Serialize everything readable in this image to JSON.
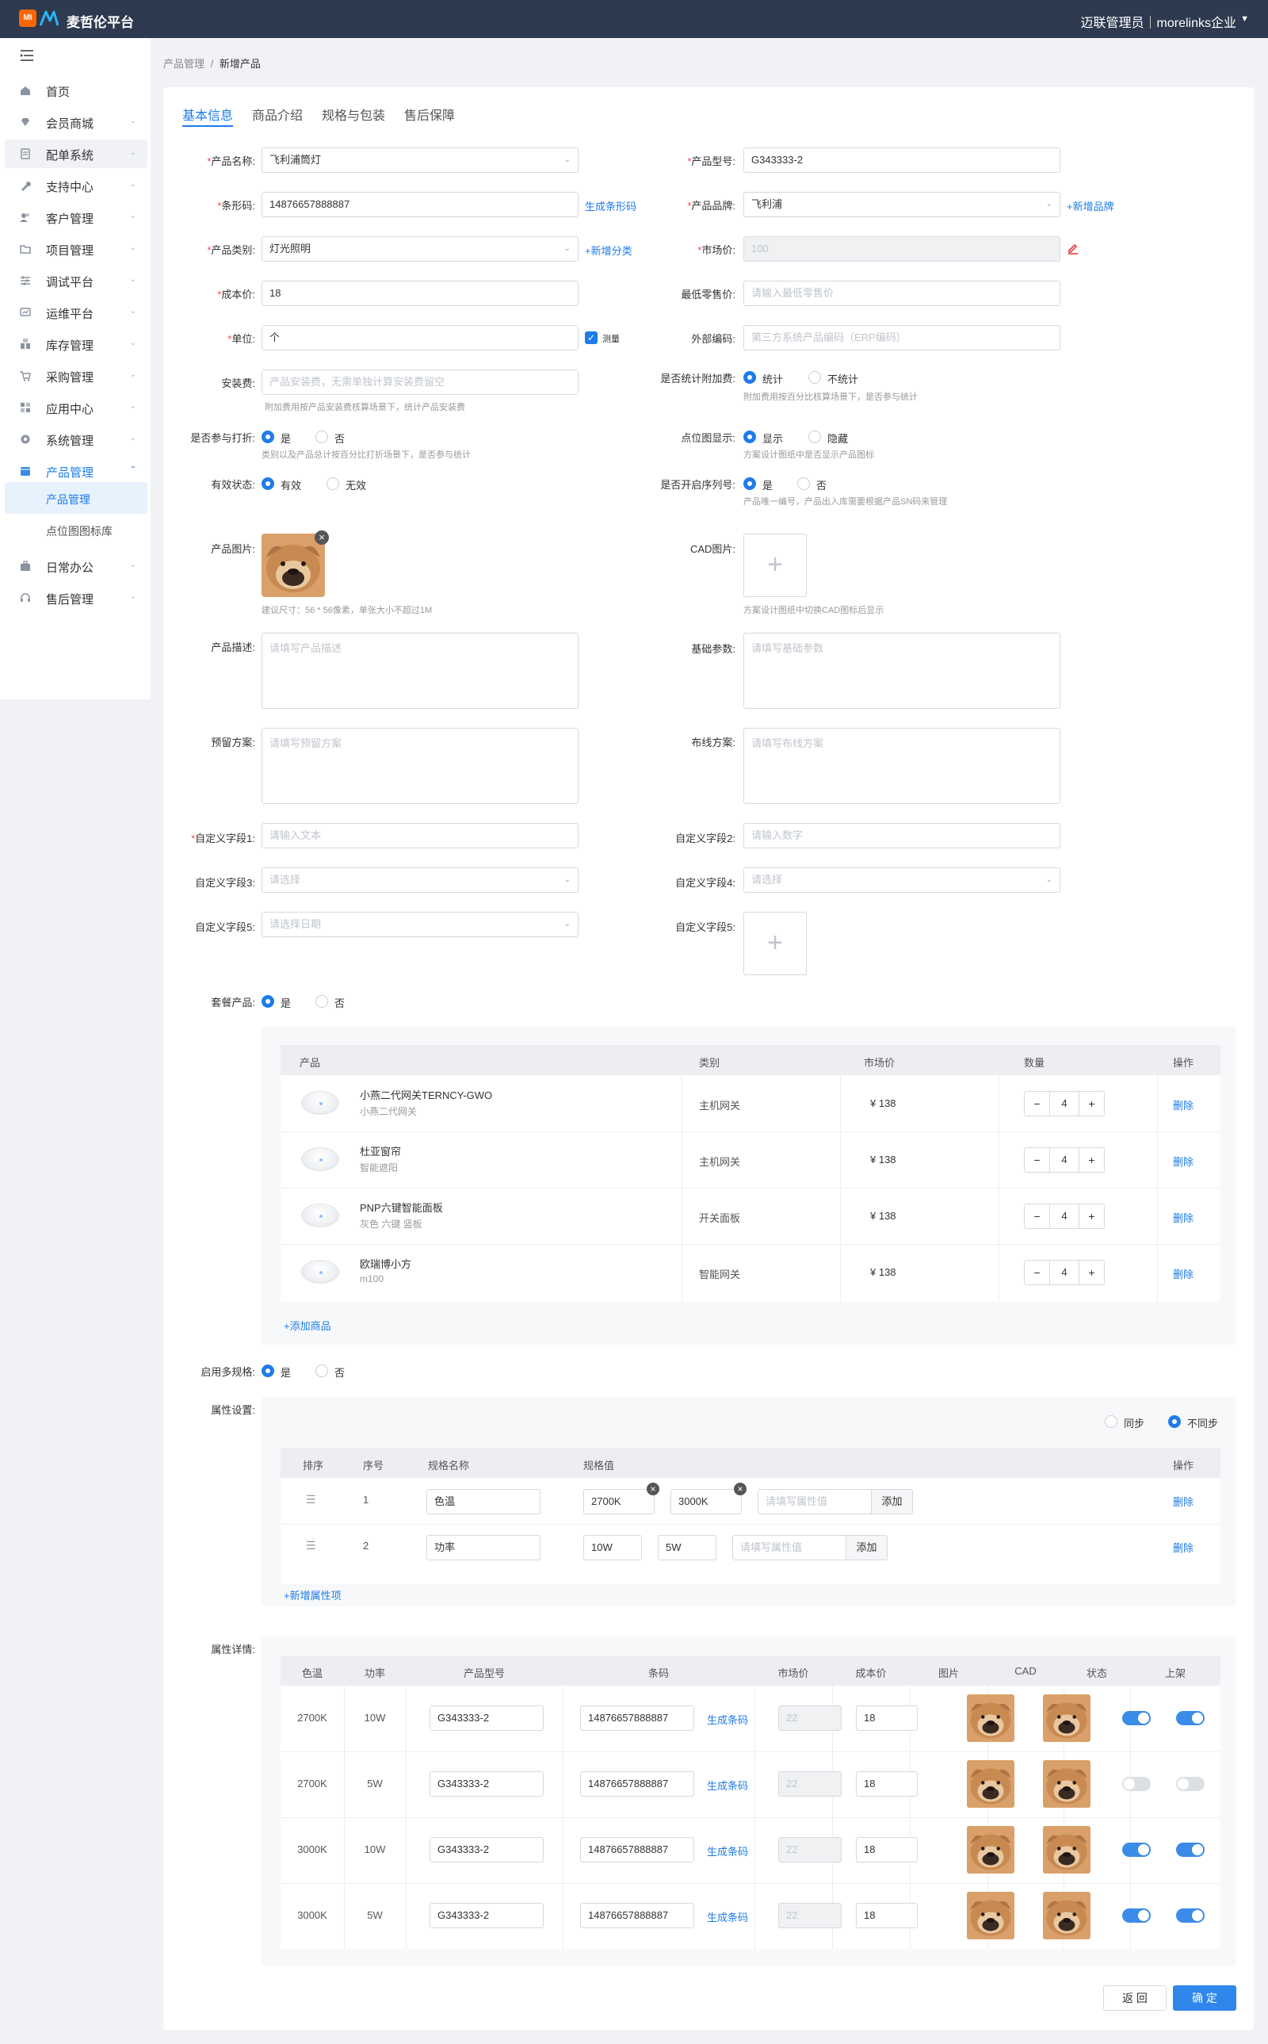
{
  "app": {
    "logo_text": "MI",
    "title": "麦哲伦平台",
    "user": "迈联管理员｜morelinks企业"
  },
  "sidebar": {
    "items": [
      {
        "label": "首页",
        "icon": "home-icon"
      },
      {
        "label": "会员商城",
        "icon": "diamond-icon"
      },
      {
        "label": "配单系统",
        "icon": "order-icon"
      },
      {
        "label": "支持中心",
        "icon": "wrench-icon"
      },
      {
        "label": "客户管理",
        "icon": "customer-icon"
      },
      {
        "label": "项目管理",
        "icon": "folder-icon"
      },
      {
        "label": "调试平台",
        "icon": "sliders-icon"
      },
      {
        "label": "运维平台",
        "icon": "monitor-icon"
      },
      {
        "label": "库存管理",
        "icon": "warehouse-icon"
      },
      {
        "label": "采购管理",
        "icon": "cart-icon"
      },
      {
        "label": "应用中心",
        "icon": "apps-icon"
      },
      {
        "label": "系统管理",
        "icon": "gear-icon"
      },
      {
        "label": "产品管理",
        "icon": "product-icon"
      },
      {
        "label": "日常办公",
        "icon": "briefcase-icon"
      },
      {
        "label": "售后管理",
        "icon": "headset-icon"
      }
    ],
    "sub_items": [
      {
        "label": "产品管理"
      },
      {
        "label": "点位图图标库"
      }
    ]
  },
  "breadcrumb": {
    "parent": "产品管理",
    "separator": "/",
    "current": "新增产品"
  },
  "tabs": [
    {
      "label": "基本信息"
    },
    {
      "label": "商品介绍"
    },
    {
      "label": "规格与包装"
    },
    {
      "label": "售后保障"
    }
  ],
  "form": {
    "name_label": "产品名称:",
    "name_value": "飞利浦筒灯",
    "model_label": "产品型号:",
    "model_value": "G343333-2",
    "barcode_label": "条形码:",
    "barcode_value": "14876657888887",
    "barcode_link": "生成条形码",
    "brand_label": "产品品牌:",
    "brand_value": "飞利浦",
    "brand_link": "+新增品牌",
    "category_label": "产品类别:",
    "category_value": "灯光照明",
    "category_link": "+新增分类",
    "market_price_label": "市场价:",
    "market_price_value": "100",
    "cost_label": "成本价:",
    "cost_value": "18",
    "min_retail_label": "最低零售价:",
    "min_retail_placeholder": "请输入最低零售价",
    "unit_label": "单位:",
    "unit_value": "个",
    "measure_label": "测量",
    "external_code_label": "外部编码:",
    "external_code_placeholder": "第三方系统产品编码（ERP编码）",
    "install_fee_label": "安装费:",
    "install_fee_placeholder": "产品安装费，无需单独计算安装费留空",
    "install_fee_hint": "附加费用按产品安装费核算场景下，统计产品安装费",
    "surcharge_label": "是否统计附加费:",
    "surcharge_yes": "统计",
    "surcharge_no": "不统计",
    "surcharge_hint": "附加费用按百分比核算场景下，是否参与统计",
    "discount_label": "是否参与打折:",
    "discount_yes": "是",
    "discount_no": "否",
    "discount_hint": "类别以及产品总计按百分比打折场景下，是否参与统计",
    "point_label": "点位图显示:",
    "point_yes": "显示",
    "point_no": "隐藏",
    "point_hint": "方案设计图纸中是否显示产品图标",
    "status_label": "有效状态:",
    "status_yes": "有效",
    "status_no": "无效",
    "serial_label": "是否开启序列号:",
    "serial_yes": "是",
    "serial_no": "否",
    "serial_hint": "产品唯一编号，产品出入库需要根据产品SN码来管理",
    "image_label": "产品图片:",
    "image_hint": "建议尺寸：56 * 56像素，单张大小不超过1M",
    "cad_label": "CAD图片:",
    "cad_hint": "方案设计图纸中切换CAD图标后显示",
    "desc_label": "产品描述:",
    "desc_placeholder": "请填写产品描述",
    "params_label": "基础参数:",
    "params_placeholder": "请填写基础参数",
    "reserve_label": "预留方案:",
    "reserve_placeholder": "请填写预留方案",
    "wiring_label": "布线方案:",
    "wiring_placeholder": "请填写布线方案",
    "custom1_label": "自定义字段1:",
    "custom1_placeholder": "请输入文本",
    "custom2_label": "自定义字段2:",
    "custom2_placeholder": "请输入数字",
    "custom3_label": "自定义字段3:",
    "custom3_placeholder": "请选择",
    "custom4_label": "自定义字段4:",
    "custom4_placeholder": "请选择",
    "custom5_label": "自定义字段5:",
    "custom5_placeholder": "请选择日期",
    "custom5b_label": "自定义字段5:",
    "package_label": "套餐产品:",
    "package_yes": "是",
    "package_no": "否",
    "multi_spec_label": "启用多规格:",
    "multi_spec_yes": "是",
    "multi_spec_no": "否",
    "attr_setting_label": "属性设置:",
    "attr_detail_label": "属性详情:",
    "sync_label": "同步",
    "nosync_label": "不同步"
  },
  "package_table": {
    "headers": [
      "产品",
      "类别",
      "市场价",
      "数量",
      "操作"
    ],
    "rows": [
      {
        "name": "小燕二代网关TERNCY-GWO",
        "sub": "小燕二代网关",
        "category": "主机网关",
        "price": "¥ 138",
        "qty": "4",
        "action": "删除"
      },
      {
        "name": "杜亚窗帘",
        "sub": "智能遮阳",
        "category": "主机网关",
        "price": "¥ 138",
        "qty": "4",
        "action": "删除"
      },
      {
        "name": "PNP六键智能面板",
        "sub": "灰色 六键 竖板",
        "category": "开关面板",
        "price": "¥ 138",
        "qty": "4",
        "action": "删除"
      },
      {
        "name": "欧瑞博小方",
        "sub": "m100",
        "category": "智能网关",
        "price": "¥ 138",
        "qty": "4",
        "action": "删除"
      }
    ],
    "add_link": "+添加商品"
  },
  "attr_table": {
    "headers": [
      "排序",
      "序号",
      "规格名称",
      "规格值",
      "操作"
    ],
    "rows": [
      {
        "index": "1",
        "name": "色温",
        "values": [
          "2700K",
          "3000K"
        ],
        "placeholder": "请填写属性值",
        "add": "添加",
        "action": "删除"
      },
      {
        "index": "2",
        "name": "功率",
        "values": [
          "10W",
          "5W"
        ],
        "placeholder": "请填写属性值",
        "add": "添加",
        "action": "删除"
      }
    ],
    "add_link": "+新增属性项"
  },
  "detail_table": {
    "headers": [
      "色温",
      "功率",
      "产品型号",
      "条码",
      "市场价",
      "成本价",
      "图片",
      "CAD",
      "状态",
      "上架"
    ],
    "gen_link": "生成条码",
    "rows": [
      {
        "temp": "2700K",
        "power": "10W",
        "model": "G343333-2",
        "barcode": "14876657888887",
        "market": "22",
        "cost": "18",
        "status": "on",
        "shelf": "on"
      },
      {
        "temp": "2700K",
        "power": "5W",
        "model": "G343333-2",
        "barcode": "14876657888887",
        "market": "22",
        "cost": "18",
        "status": "off",
        "shelf": "off"
      },
      {
        "temp": "3000K",
        "power": "10W",
        "model": "G343333-2",
        "barcode": "14876657888887",
        "market": "22",
        "cost": "18",
        "status": "on",
        "shelf": "on"
      },
      {
        "temp": "3000K",
        "power": "5W",
        "model": "G343333-2",
        "barcode": "14876657888887",
        "market": "22",
        "cost": "18",
        "status": "on",
        "shelf": "on"
      }
    ]
  },
  "footer": {
    "back_label": "返 回",
    "confirm_label": "确 定"
  },
  "colors": {
    "primary": "#1e7ce8",
    "topbar": "#2d3a4f",
    "required": "#f04848",
    "brand_orange": "#ff6700"
  }
}
